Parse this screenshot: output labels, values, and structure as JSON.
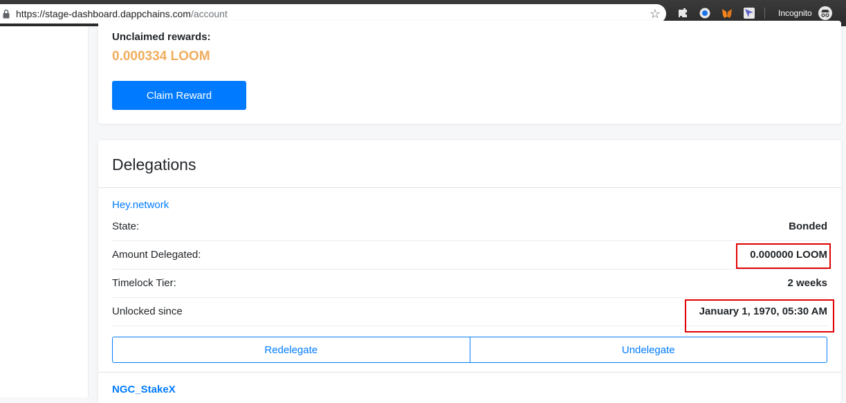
{
  "browser": {
    "url_host": "https://stage-dashboard.dappchains.com",
    "url_path": "/account",
    "incognito_label": "Incognito"
  },
  "rewards": {
    "title": "Unclaimed rewards:",
    "amount": "0.000334 LOOM",
    "claim_label": "Claim Reward"
  },
  "delegations": {
    "title": "Delegations",
    "validators": [
      {
        "name": "Hey.network",
        "rows": [
          {
            "label": "State:",
            "value": "Bonded"
          },
          {
            "label": "Amount Delegated:",
            "value": "0.000000 LOOM"
          },
          {
            "label": "Timelock Tier:",
            "value": "2 weeks"
          },
          {
            "label": "Unlocked since",
            "value": "January 1, 1970, 05:30 AM"
          }
        ],
        "actions": {
          "redelegate_label": "Redelegate",
          "undelegate_label": "Undelegate"
        }
      },
      {
        "name": "NGC_StakeX"
      }
    ]
  },
  "colors": {
    "primary": "#007bff",
    "reward_amount": "#f0ad5e",
    "highlight": "#e00000"
  }
}
